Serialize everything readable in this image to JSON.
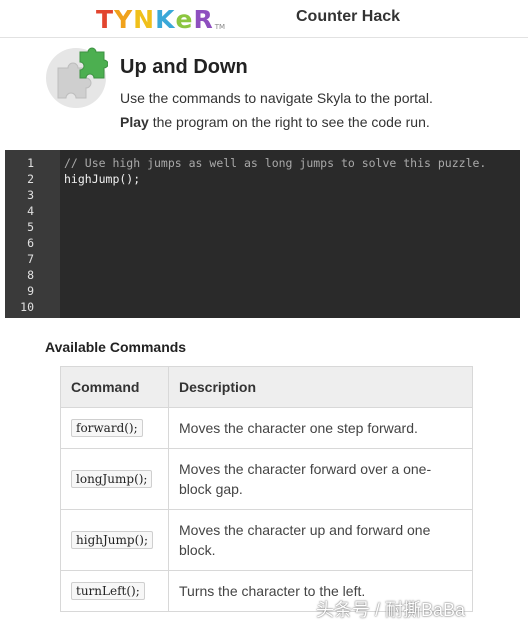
{
  "header": {
    "logo_letters": [
      {
        "char": "T",
        "color": "#e2452f"
      },
      {
        "char": "Y",
        "color": "#f0a21b"
      },
      {
        "char": "N",
        "color": "#f0c01b"
      },
      {
        "char": "K",
        "color": "#3aa8d8"
      },
      {
        "char": "e",
        "color": "#8cc63f"
      },
      {
        "char": "R",
        "color": "#8e4fbf"
      }
    ],
    "logo_tm": "TM",
    "title": "Counter Hack"
  },
  "intro": {
    "icon": "puzzle-piece-icon",
    "title": "Up and Down",
    "line1": "Use the commands to navigate Skyla to the portal.",
    "line2_bold": "Play",
    "line2_rest": " the program on the right to see the code run."
  },
  "editor": {
    "line_numbers": [
      "1",
      "2",
      "3",
      "4",
      "5",
      "6",
      "7",
      "8",
      "9",
      "10"
    ],
    "lines": [
      "// Use high jumps as well as long jumps to solve this puzzle.",
      "highJump();",
      "",
      "",
      "",
      "",
      "",
      "",
      "",
      ""
    ]
  },
  "commands": {
    "section_title": "Available Commands",
    "headers": {
      "command": "Command",
      "description": "Description"
    },
    "rows": [
      {
        "command": "forward();",
        "description": "Moves the character one step forward."
      },
      {
        "command": "longJump();",
        "description": "Moves the character forward over a one-block gap."
      },
      {
        "command": "highJump();",
        "description": "Moves the character up and forward one block."
      },
      {
        "command": "turnLeft();",
        "description": "Turns the character to the left."
      }
    ]
  },
  "watermark": "头条号 / 耐撕BaBa",
  "colors": {
    "editor_bg": "#2a2a2a",
    "gutter_bg": "#3a3a3a",
    "puzzle_green": "#4caf50",
    "puzzle_gray": "#cfcfcf"
  }
}
